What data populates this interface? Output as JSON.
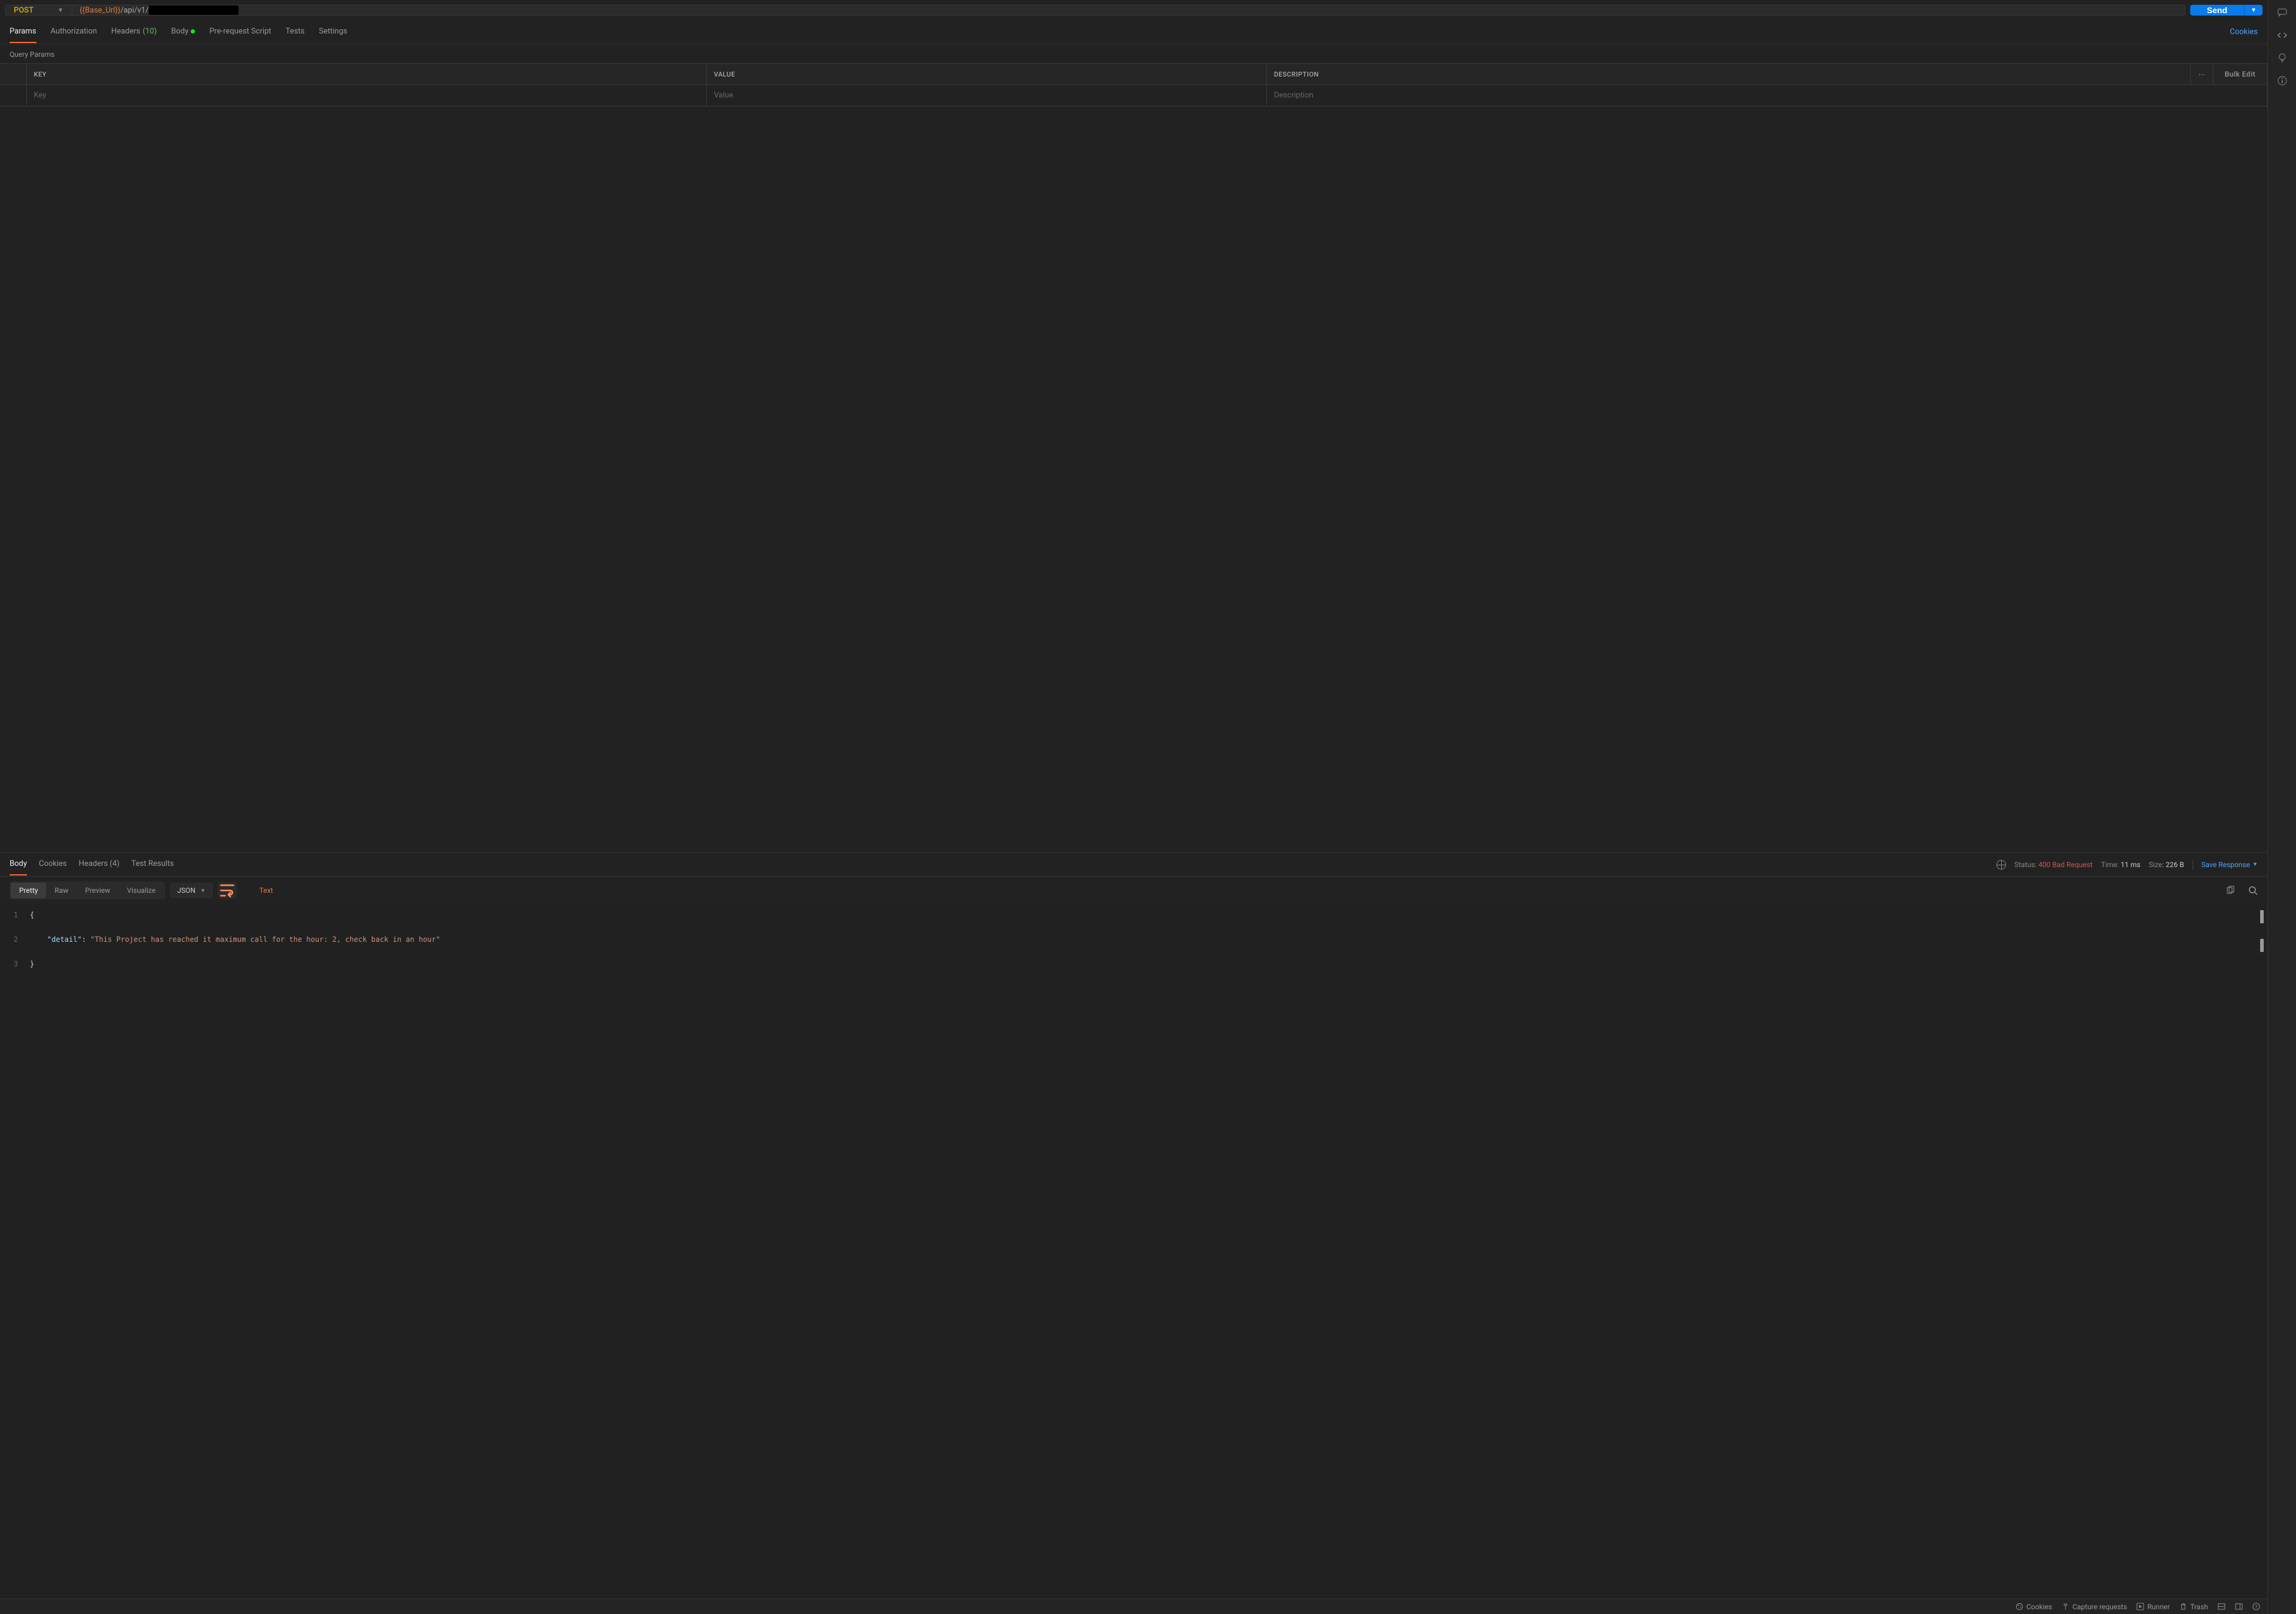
{
  "request": {
    "method": "POST",
    "url_variable": "{{Base_Url}}",
    "url_path": "/api/v1/",
    "send_label": "Send"
  },
  "tabs": {
    "params": "Params",
    "authorization": "Authorization",
    "headers": "Headers",
    "headers_count": "(10)",
    "body": "Body",
    "prerequest": "Pre-request Script",
    "tests": "Tests",
    "settings": "Settings",
    "cookies_link": "Cookies"
  },
  "query_params": {
    "title": "Query Params",
    "key_header": "KEY",
    "value_header": "VALUE",
    "description_header": "DESCRIPTION",
    "bulk_edit": "Bulk Edit",
    "key_placeholder": "Key",
    "value_placeholder": "Value",
    "description_placeholder": "Description"
  },
  "response_tabs": {
    "body": "Body",
    "cookies": "Cookies",
    "headers": "Headers",
    "headers_count": "(4)",
    "test_results": "Test Results"
  },
  "response_meta": {
    "status_label": "Status:",
    "status_value": "400 Bad Request",
    "time_label": "Time:",
    "time_value": "11 ms",
    "size_label": "Size:",
    "size_value": "226 B",
    "save_response": "Save Response"
  },
  "view_modes": {
    "pretty": "Pretty",
    "raw": "Raw",
    "preview": "Preview",
    "visualize": "Visualize",
    "type": "JSON",
    "text_label": "Text"
  },
  "response_body": {
    "line1": "{",
    "line2_key": "\"detail\"",
    "line2_val": "\"This Project has reached it maximum call for the hour: 2, check back in an hour\"",
    "line3": "}"
  },
  "bottom_bar": {
    "cookies": "Cookies",
    "capture": "Capture requests",
    "runner": "Runner",
    "trash": "Trash"
  }
}
